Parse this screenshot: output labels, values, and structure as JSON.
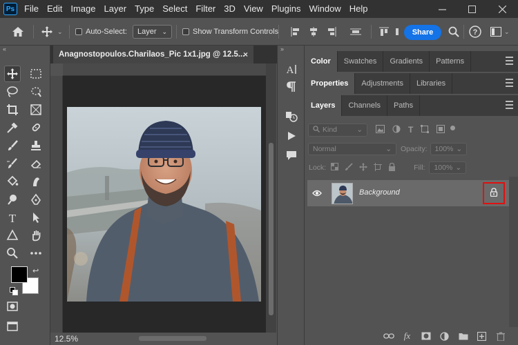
{
  "app": {
    "logo": "Ps"
  },
  "menu": [
    "File",
    "Edit",
    "Image",
    "Layer",
    "Type",
    "Select",
    "Filter",
    "3D",
    "View",
    "Plugins",
    "Window",
    "Help"
  ],
  "options_bar": {
    "auto_select_label": "Auto-Select:",
    "auto_select_value": "Layer",
    "show_transform_label": "Show Transform Controls",
    "share_label": "Share"
  },
  "document": {
    "tab_title": "Anagnostopoulos.Charilaos_Pic 1x1.jpg @ 12.5...",
    "close_glyph": "×",
    "zoom": "12.5%"
  },
  "panels": {
    "top_tabs": [
      "Color",
      "Swatches",
      "Gradients",
      "Patterns"
    ],
    "mid_tabs": [
      "Properties",
      "Adjustments",
      "Libraries"
    ],
    "layer_tabs": [
      "Layers",
      "Channels",
      "Paths"
    ],
    "filter_kind": "Kind",
    "blend_mode": "Normal",
    "opacity_label": "Opacity:",
    "opacity_value": "100%",
    "lock_label": "Lock:",
    "fill_label": "Fill:",
    "fill_value": "100%",
    "layer_name": "Background"
  },
  "colors": {
    "accent": "#1473e6",
    "highlight_box": "#e01010",
    "foreground": "#000000",
    "background": "#ffffff"
  }
}
